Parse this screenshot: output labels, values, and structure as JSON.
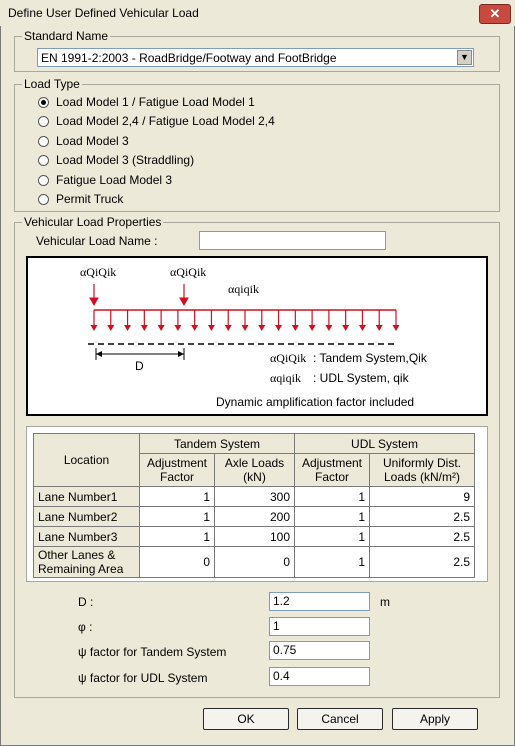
{
  "window": {
    "title": "Define User Defined Vehicular Load",
    "close_glyph": "✕"
  },
  "standard": {
    "legend": "Standard Name",
    "selected": "EN 1991-2:2003 - RoadBridge/Footway and FootBridge",
    "arrow": "▼"
  },
  "load_type": {
    "legend": "Load Type",
    "options": [
      {
        "label": "Load Model 1 /  Fatigue Load Model 1",
        "selected": true
      },
      {
        "label": "Load Model 2,4 / Fatigue Load Model 2,4",
        "selected": false
      },
      {
        "label": "Load Model 3",
        "selected": false
      },
      {
        "label": "Load Model 3 (Straddling)",
        "selected": false
      },
      {
        "label": "Fatigue Load Model 3",
        "selected": false
      },
      {
        "label": "Permit Truck",
        "selected": false
      }
    ]
  },
  "properties": {
    "legend": "Vehicular Load Properties",
    "name_label": "Vehicular Load Name :",
    "name_value": ""
  },
  "diagram": {
    "label_tandem_1": "αQiQik",
    "label_tandem_2": "αQiQik",
    "label_udl": "αqiqik",
    "dim_label": "D",
    "legend_tandem_sym": "αQiQik",
    "legend_tandem_text": ": Tandem System,Qik",
    "legend_udl_sym": "αqiqik",
    "legend_udl_text": ": UDL System, qik",
    "note": "Dynamic amplification factor included",
    "load_color": "#d01020"
  },
  "table": {
    "col_location": "Location",
    "group_tandem": "Tandem System",
    "group_udl": "UDL System",
    "col_adj": "Adjustment Factor",
    "col_axle": "Axle Loads (kN)",
    "col_adj2": "Adjustment Factor",
    "col_udl": "Uniformly Dist. Loads (kN/m²)",
    "rows": [
      {
        "location": "Lane Number1",
        "tandem_adj": "1",
        "axle": "300",
        "udl_adj": "1",
        "udl": "9"
      },
      {
        "location": "Lane Number2",
        "tandem_adj": "1",
        "axle": "200",
        "udl_adj": "1",
        "udl": "2.5"
      },
      {
        "location": "Lane Number3",
        "tandem_adj": "1",
        "axle": "100",
        "udl_adj": "1",
        "udl": "2.5"
      },
      {
        "location": "Other Lanes & Remaining Area",
        "tandem_adj": "0",
        "axle": "0",
        "udl_adj": "1",
        "udl": "2.5"
      }
    ]
  },
  "params": {
    "d_label": "D :",
    "d_value": "1.2",
    "d_unit": "m",
    "phi_label": "φ :",
    "phi_value": "1",
    "psi_tandem_label": "ψ factor for Tandem System",
    "psi_tandem_value": "0.75",
    "psi_udl_label": "ψ factor for UDL System",
    "psi_udl_value": "0.4"
  },
  "buttons": {
    "ok": "OK",
    "cancel": "Cancel",
    "apply": "Apply"
  }
}
